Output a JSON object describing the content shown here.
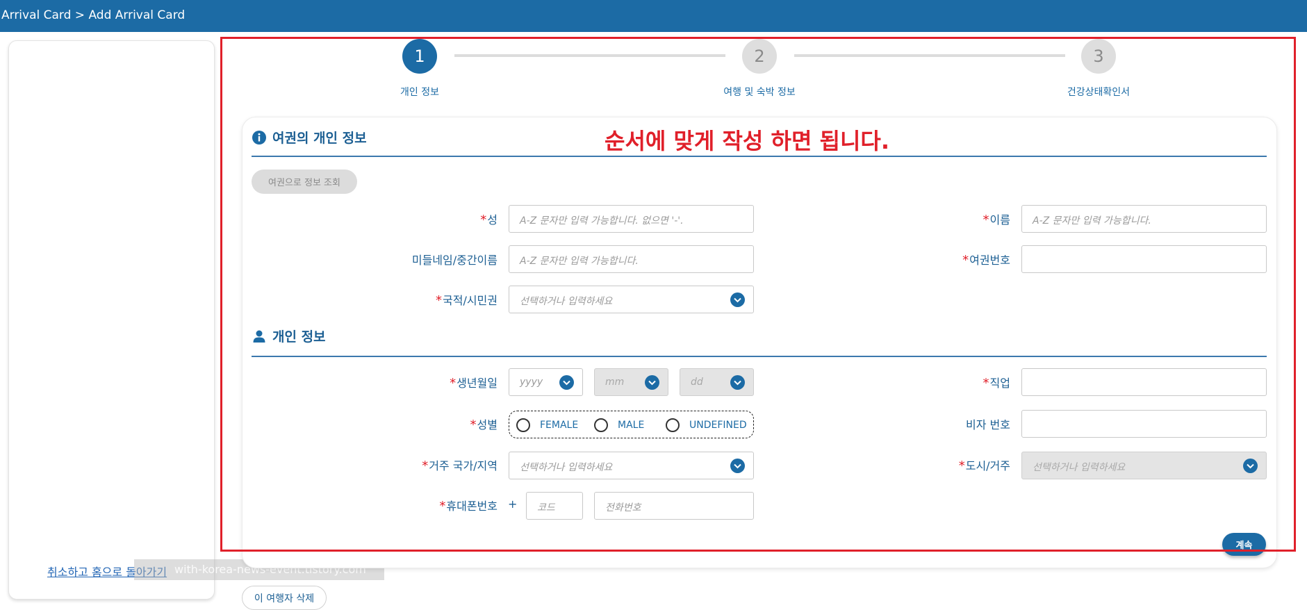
{
  "header": {
    "breadcrumb": "Arrival Card > Add Arrival Card"
  },
  "sidebar": {
    "cancel_link": "취소하고 홈으로 돌아가기"
  },
  "watermark": "with-korea-news-event.tistory.com",
  "stepper": {
    "steps": [
      {
        "number": "1",
        "label": "개인 정보",
        "active": true
      },
      {
        "number": "2",
        "label": "여행 및 숙박 정보",
        "active": false
      },
      {
        "number": "3",
        "label": "건강상태확인서",
        "active": false
      }
    ]
  },
  "annotation": "순서에 맞게 작성 하면 됩니다.",
  "passport_section": {
    "title": "여권의 개인 정보",
    "lookup_button": "여권으로 정보 조회",
    "surname": {
      "label": "성",
      "placeholder": "A-Z 문자만 입력 가능합니다. 없으면 '-'."
    },
    "given_name": {
      "label": "이름",
      "placeholder": "A-Z 문자만 입력 가능합니다."
    },
    "middle_name": {
      "label": "미들네임/중간이름",
      "placeholder": "A-Z 문자만 입력 가능합니다."
    },
    "passport_no": {
      "label": "여권번호",
      "placeholder": ""
    },
    "nationality": {
      "label": "국적/시민권",
      "placeholder": "선택하거나 입력하세요"
    }
  },
  "personal_section": {
    "title": "개인 정보",
    "dob": {
      "label": "생년월일",
      "year": "yyyy",
      "month": "mm",
      "day": "dd"
    },
    "occupation": {
      "label": "직업",
      "placeholder": ""
    },
    "gender": {
      "label": "성별",
      "options": [
        "FEMALE",
        "MALE",
        "UNDEFINED"
      ]
    },
    "visa_no": {
      "label": "비자 번호",
      "placeholder": ""
    },
    "residence_country": {
      "label": "거주 국가/지역",
      "placeholder": "선택하거나 입력하세요"
    },
    "city": {
      "label": "도시/거주",
      "placeholder": "선택하거나 입력하세요"
    },
    "phone": {
      "label": "휴대폰번호",
      "prefix": "+",
      "code_placeholder": "코드",
      "number_placeholder": "전화번호"
    }
  },
  "buttons": {
    "continue": "계속",
    "delete_traveler": "이 여행자 삭제"
  },
  "colors": {
    "primary": "#1c6ba5",
    "required": "#e0202a",
    "annotation": "#e0202a"
  },
  "icons": {
    "passport_section": "info-icon",
    "personal_section": "person-icon",
    "dropdown": "chevron-down-icon"
  }
}
